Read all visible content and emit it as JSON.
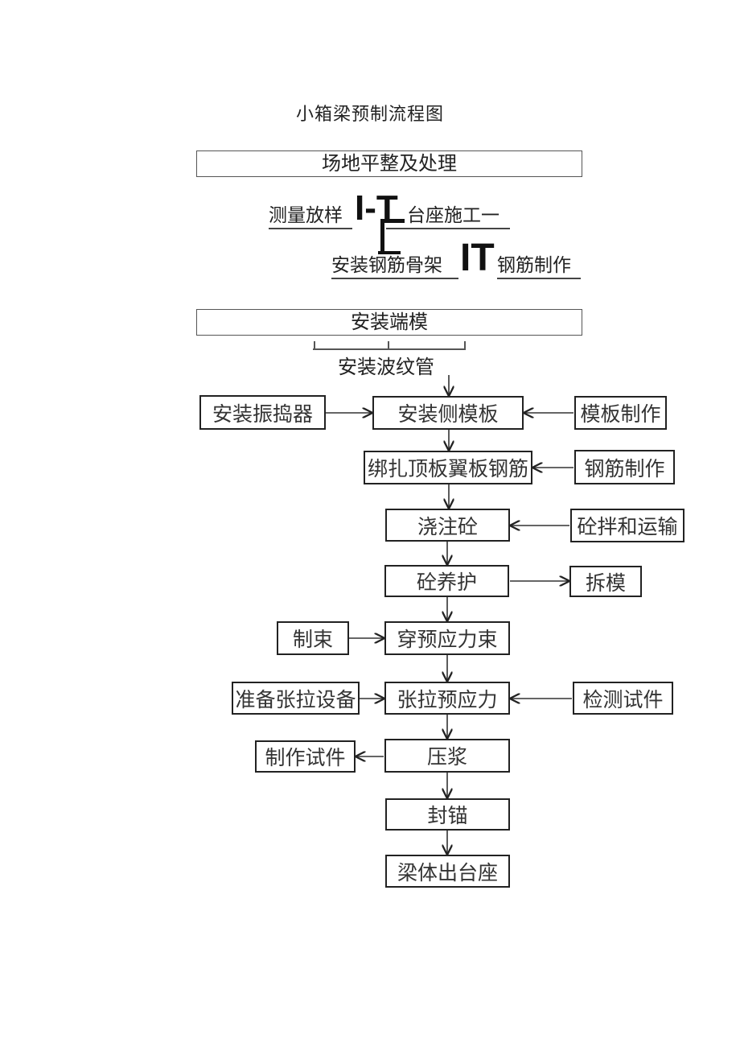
{
  "title": "小箱梁预制流程图",
  "top_section": {
    "site_prep": "场地平整及处理",
    "survey": "测量放样",
    "survey_glyph": "I-T",
    "pedestal": "台座施工一",
    "install_skeleton": "安装钢筋骨架",
    "skeleton_glyph": "IT",
    "rebar_fabrication": "钢筋制作",
    "end_form": "安装端模",
    "duct": "安装波纹管"
  },
  "main_flow": [
    {
      "id": "side-form",
      "label": "安装侧模板"
    },
    {
      "id": "top-rebar",
      "label": "绑扎顶板翼板钢筋"
    },
    {
      "id": "pour",
      "label": "浇注砼"
    },
    {
      "id": "cure",
      "label": "砼养护"
    },
    {
      "id": "thread-tendon",
      "label": "穿预应力束"
    },
    {
      "id": "tension",
      "label": "张拉预应力"
    },
    {
      "id": "grout",
      "label": "压浆"
    },
    {
      "id": "seal-anchor",
      "label": "封锚"
    },
    {
      "id": "beam-out",
      "label": "梁体出台座"
    }
  ],
  "side_nodes": [
    {
      "id": "vibrator",
      "label": "安装振捣器",
      "target": "side-form",
      "direction": "into"
    },
    {
      "id": "form-fab",
      "label": "模板制作",
      "target": "side-form",
      "direction": "into"
    },
    {
      "id": "rebar-fab",
      "label": "钢筋制作",
      "target": "top-rebar",
      "direction": "into"
    },
    {
      "id": "concrete-mix",
      "label": "砼拌和运输",
      "target": "pour",
      "direction": "into"
    },
    {
      "id": "demold",
      "label": "拆模",
      "target": "cure",
      "direction": "out"
    },
    {
      "id": "make-tendon",
      "label": "制束",
      "target": "thread-tendon",
      "direction": "into"
    },
    {
      "id": "prep-tension",
      "label": "准备张拉设备",
      "target": "tension",
      "direction": "into"
    },
    {
      "id": "test-specimen",
      "label": "检测试件",
      "target": "tension",
      "direction": "into"
    },
    {
      "id": "make-specimen",
      "label": "制作试件",
      "target": "grout",
      "direction": "out"
    }
  ]
}
